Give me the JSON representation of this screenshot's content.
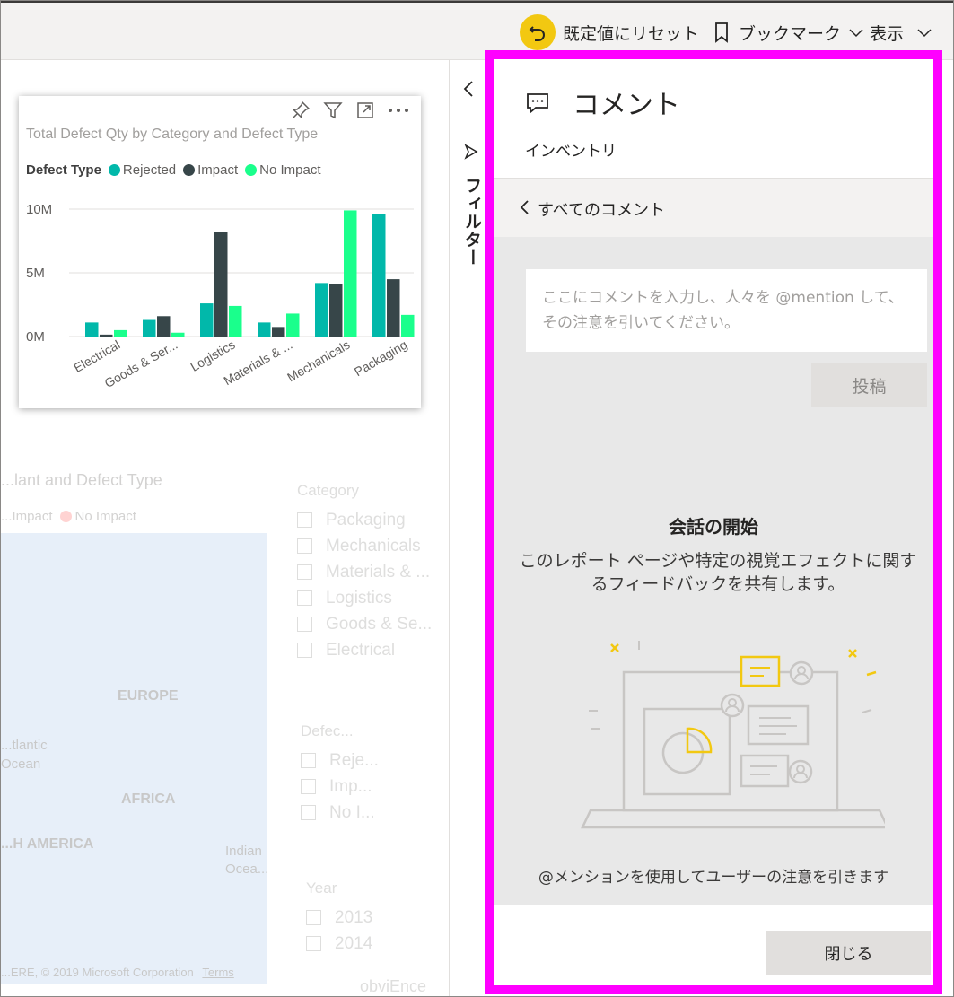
{
  "toolbar": {
    "reset_label": "既定値にリセット",
    "bookmark_label": "ブックマーク",
    "view_label": "表示"
  },
  "filters": {
    "label": "フィルター"
  },
  "chart": {
    "title": "Total Defect Qty by Category and Defect Type",
    "legend_title": "Defect Type",
    "colors": {
      "Rejected": "#01b8aa",
      "Impact": "#374649",
      "No Impact": "#1aff8c"
    }
  },
  "chart_data": {
    "type": "bar",
    "title": "Total Defect Qty by Category and Defect Type",
    "categories": [
      "Electrical",
      "Goods & Ser...",
      "Logistics",
      "Materials & ...",
      "Mechanicals",
      "Packaging"
    ],
    "series": [
      {
        "name": "Rejected",
        "values": [
          1.1,
          1.3,
          2.6,
          1.1,
          4.2,
          9.6
        ]
      },
      {
        "name": "Impact",
        "values": [
          0.15,
          1.6,
          8.2,
          0.75,
          4.1,
          4.5
        ]
      },
      {
        "name": "No Impact",
        "values": [
          0.5,
          0.3,
          2.4,
          1.8,
          9.9,
          1.7
        ]
      }
    ],
    "yticks": [
      "0M",
      "5M",
      "10M"
    ],
    "ylim": [
      0,
      10
    ],
    "ylabel": "",
    "xlabel": "",
    "legend_position": "top-left",
    "grid": true
  },
  "background": {
    "map_title": "...lant and Defect Type",
    "map_legend": [
      "...Impact",
      "No Impact"
    ],
    "map_labels": [
      "EUROPE",
      "AFRICA",
      "...H AMERICA"
    ],
    "map_sub_labels": [
      "...tlantic",
      "Ocean",
      "Indian",
      "Ocea..."
    ],
    "map_credit": "...ERE, © 2019 Microsoft Corporation",
    "map_terms": "Terms",
    "category_slicer": {
      "title": "Category",
      "items": [
        "Packaging",
        "Mechanicals",
        "Materials & ...",
        "Logistics",
        "Goods & Se...",
        "Electrical"
      ]
    },
    "defect_slicer": {
      "title": "Defec...",
      "items": [
        "Reje...",
        "Imp...",
        "No I..."
      ]
    },
    "year_slicer": {
      "title": "Year",
      "items": [
        "2013",
        "2014"
      ]
    },
    "footer_text": "obviEnce"
  },
  "comments": {
    "title": "コメント",
    "subtitle": "インベントリ",
    "back_label": "すべてのコメント",
    "input_placeholder": "ここにコメントを入力し、人々を @mention して、その注意を引いてください。",
    "post_label": "投稿",
    "conversation_title": "会話の開始",
    "conversation_desc": "このレポート ページや特定の視覚エフェクトに関するフィードバックを共有します。",
    "mention_hint": "@メンションを使用してユーザーの注意を引きます",
    "close_label": "閉じる",
    "accent_color": "#ff00ff"
  }
}
